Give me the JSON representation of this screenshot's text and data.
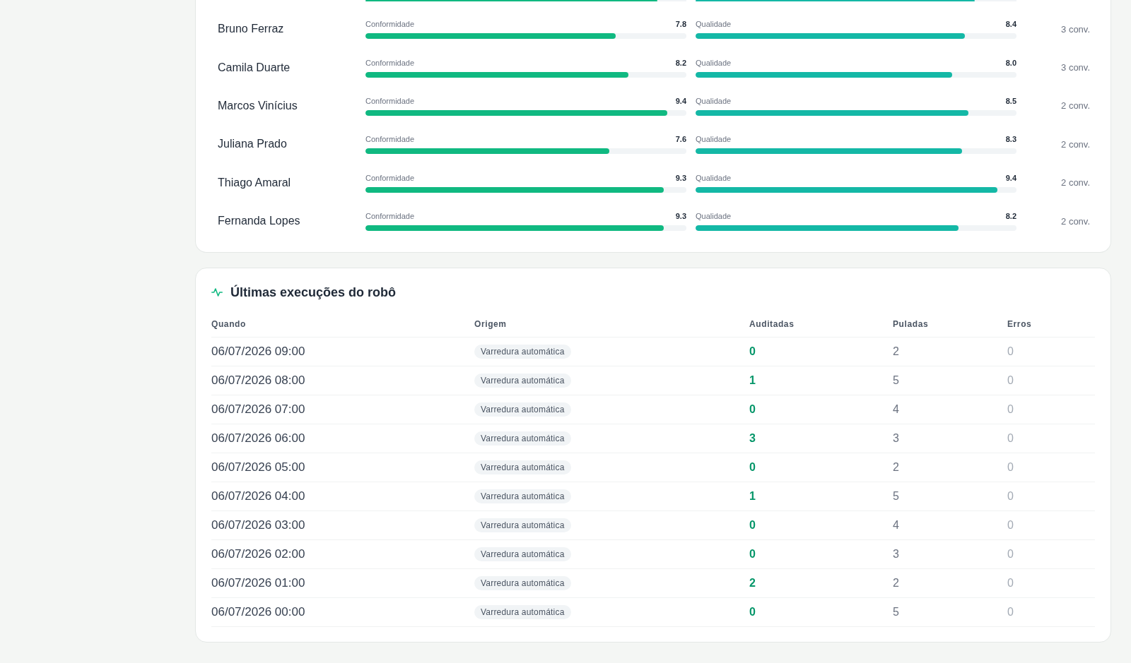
{
  "scores_card": {
    "partial_row": {
      "metrics": [
        {
          "level": 0.91,
          "color": "#10b981"
        },
        {
          "level": 0.87,
          "color": "#14b8a6"
        }
      ]
    },
    "agents": [
      {
        "name": "Bruno Ferraz",
        "metrics": [
          {
            "label": "Conformidade",
            "score": "7.8",
            "level": 0.78,
            "color": "#10b981"
          },
          {
            "label": "Qualidade",
            "score": "8.4",
            "level": 0.84,
            "color": "#14b8a6"
          }
        ],
        "conversations": "3 conv."
      },
      {
        "name": "Camila Duarte",
        "metrics": [
          {
            "label": "Conformidade",
            "score": "8.2",
            "level": 0.82,
            "color": "#10b981"
          },
          {
            "label": "Qualidade",
            "score": "8.0",
            "level": 0.8,
            "color": "#14b8a6"
          }
        ],
        "conversations": "3 conv."
      },
      {
        "name": "Marcos Vinícius",
        "metrics": [
          {
            "label": "Conformidade",
            "score": "9.4",
            "level": 0.94,
            "color": "#10b981"
          },
          {
            "label": "Qualidade",
            "score": "8.5",
            "level": 0.85,
            "color": "#14b8a6"
          }
        ],
        "conversations": "2 conv."
      },
      {
        "name": "Juliana Prado",
        "metrics": [
          {
            "label": "Conformidade",
            "score": "7.6",
            "level": 0.76,
            "color": "#10b981"
          },
          {
            "label": "Qualidade",
            "score": "8.3",
            "level": 0.83,
            "color": "#14b8a6"
          }
        ],
        "conversations": "2 conv."
      },
      {
        "name": "Thiago Amaral",
        "metrics": [
          {
            "label": "Conformidade",
            "score": "9.3",
            "level": 0.93,
            "color": "#10b981"
          },
          {
            "label": "Qualidade",
            "score": "9.4",
            "level": 0.94,
            "color": "#14b8a6"
          }
        ],
        "conversations": "2 conv."
      },
      {
        "name": "Fernanda Lopes",
        "metrics": [
          {
            "label": "Conformidade",
            "score": "9.3",
            "level": 0.93,
            "color": "#10b981"
          },
          {
            "label": "Qualidade",
            "score": "8.2",
            "level": 0.82,
            "color": "#14b8a6"
          }
        ],
        "conversations": "2 conv."
      }
    ]
  },
  "runs_card": {
    "title": "Últimas execuções do robô",
    "columns": [
      "Quando",
      "Origem",
      "Auditadas",
      "Puladas",
      "Erros"
    ],
    "rows": [
      {
        "when": "06/07/2026 09:00",
        "origin": "Varredura automática",
        "audited": "0",
        "skipped": "2",
        "errors": "0"
      },
      {
        "when": "06/07/2026 08:00",
        "origin": "Varredura automática",
        "audited": "1",
        "skipped": "5",
        "errors": "0"
      },
      {
        "when": "06/07/2026 07:00",
        "origin": "Varredura automática",
        "audited": "0",
        "skipped": "4",
        "errors": "0"
      },
      {
        "when": "06/07/2026 06:00",
        "origin": "Varredura automática",
        "audited": "3",
        "skipped": "3",
        "errors": "0"
      },
      {
        "when": "06/07/2026 05:00",
        "origin": "Varredura automática",
        "audited": "0",
        "skipped": "2",
        "errors": "0"
      },
      {
        "when": "06/07/2026 04:00",
        "origin": "Varredura automática",
        "audited": "1",
        "skipped": "5",
        "errors": "0"
      },
      {
        "when": "06/07/2026 03:00",
        "origin": "Varredura automática",
        "audited": "0",
        "skipped": "4",
        "errors": "0"
      },
      {
        "when": "06/07/2026 02:00",
        "origin": "Varredura automática",
        "audited": "0",
        "skipped": "3",
        "errors": "0"
      },
      {
        "when": "06/07/2026 01:00",
        "origin": "Varredura automática",
        "audited": "2",
        "skipped": "2",
        "errors": "0"
      },
      {
        "when": "06/07/2026 00:00",
        "origin": "Varredura automática",
        "audited": "0",
        "skipped": "5",
        "errors": "0"
      }
    ]
  }
}
